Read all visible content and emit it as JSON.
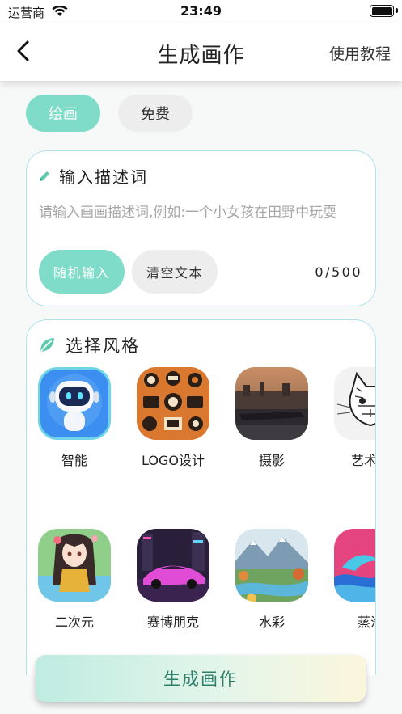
{
  "status_bar": {
    "carrier": "运营商",
    "time": "23:49"
  },
  "nav": {
    "title": "生成画作",
    "tutorial": "使用教程",
    "back_icon": "chevron-left-icon"
  },
  "chips": [
    {
      "label": "绘画",
      "active": true
    },
    {
      "label": "免费",
      "active": false
    }
  ],
  "description": {
    "title": "输入描述词",
    "icon": "pencil-icon",
    "placeholder": "请输入画画描述词,例如:一个小女孩在田野中玩耍",
    "value": "",
    "random_label": "随机输入",
    "clear_label": "清空文本",
    "counter": "0/500"
  },
  "styles": {
    "title": "选择风格",
    "icon": "leaf-icon",
    "items": [
      {
        "label": "智能",
        "selected": true
      },
      {
        "label": "LOGO设计",
        "selected": false
      },
      {
        "label": "摄影",
        "selected": false
      },
      {
        "label": "艺术沙",
        "selected": false
      },
      {
        "label": "二次元",
        "selected": false
      },
      {
        "label": "赛博朋克",
        "selected": false
      },
      {
        "label": "水彩",
        "selected": false
      },
      {
        "label": "蒸汽",
        "selected": false
      }
    ]
  },
  "generate_button": "生成画作",
  "colors": {
    "accent": "#7fdcc8",
    "card_border": "#aee3ef",
    "chip_inactive": "#ededed"
  }
}
